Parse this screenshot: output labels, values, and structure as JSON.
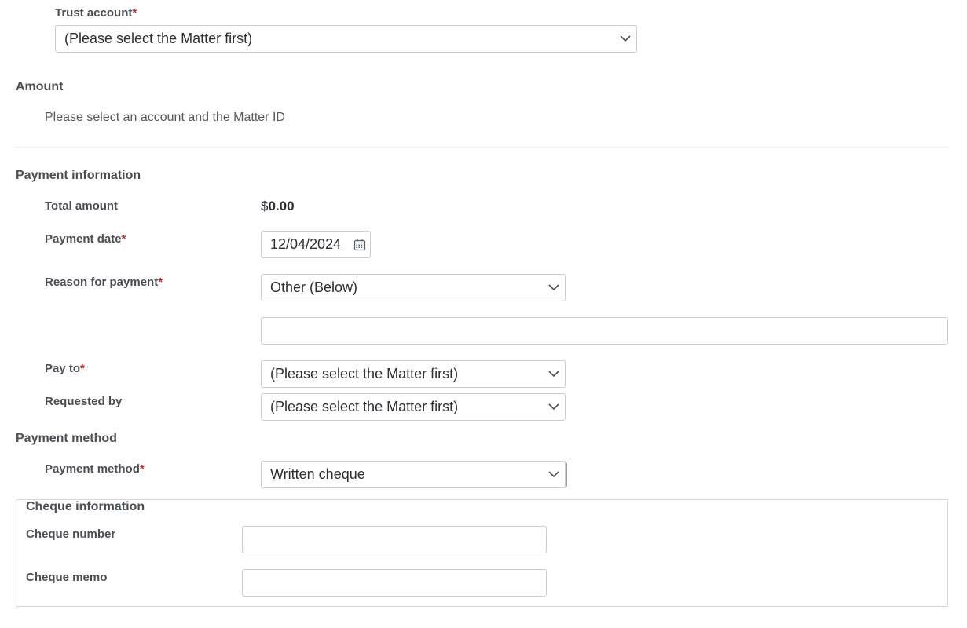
{
  "trust_account": {
    "label": "Trust account",
    "required_mark": "*",
    "value": "(Please select the Matter first)"
  },
  "amount": {
    "heading": "Amount",
    "note": "Please select an account and the Matter ID"
  },
  "payment_information": {
    "heading": "Payment information",
    "total_amount_label": "Total amount",
    "total_currency": "$",
    "total_value": "0.00",
    "payment_date_label": "Payment date",
    "payment_date_required": "*",
    "payment_date_value": "12/04/2024",
    "reason_label": "Reason for payment",
    "reason_required": "*",
    "reason_value": "Other (Below)",
    "reason_other_value": "",
    "pay_to_label": "Pay to",
    "pay_to_required": "*",
    "pay_to_value": "(Please select the Matter first)",
    "requested_by_label": "Requested by",
    "requested_by_value": "(Please select the Matter first)"
  },
  "payment_method": {
    "heading": "Payment method",
    "label": "Payment method",
    "required_mark": "*",
    "value": "Written cheque"
  },
  "cheque_information": {
    "legend": "Cheque information",
    "number_label": "Cheque number",
    "number_value": "",
    "memo_label": "Cheque memo",
    "memo_value": ""
  },
  "colors": {
    "required": "#c0282d",
    "border": "#c9ced3",
    "label": "#4a4f55"
  },
  "icons": {
    "dropdown": "chevron-down-icon",
    "date": "calendar-icon"
  }
}
